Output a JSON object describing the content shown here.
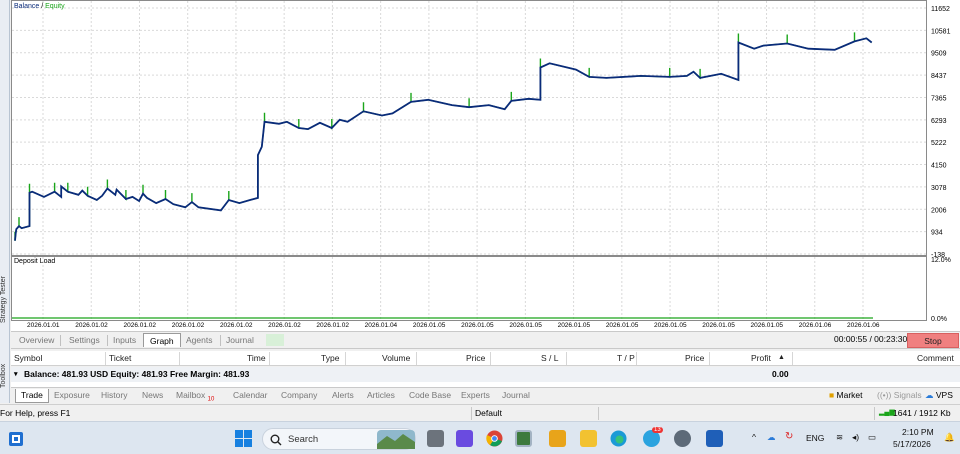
{
  "left_strip": {
    "tester_label": "Strategy Tester",
    "toolbox_label": "Toolbox"
  },
  "chart": {
    "top_label_balance": "Balance",
    "top_label_sep": " / ",
    "top_label_equity": "Equity",
    "y_ticks": [
      "11652",
      "10581",
      "9509",
      "8437",
      "7365",
      "6293",
      "5222",
      "4150",
      "3078",
      "2006",
      "934",
      "-138"
    ],
    "load_label": "Deposit Load",
    "load_ticks": [
      "12.0%",
      "0.0%"
    ],
    "x_ticks": [
      "2026.01.01",
      "2026.01.02",
      "2026.01.02",
      "2026.01.02",
      "2026.01.02",
      "2026.01.02",
      "2026.01.02",
      "2026.01.04",
      "2026.01.05",
      "2026.01.05",
      "2026.01.05",
      "2026.01.05",
      "2026.01.05",
      "2026.01.05",
      "2026.01.05",
      "2026.01.05",
      "2026.01.06",
      "2026.01.06"
    ],
    "colors": {
      "balance": "#0a2b7a",
      "equity": "#1aa51a",
      "grid": "#d9d9d9",
      "load": "#1aa51a"
    }
  },
  "chart_data": {
    "type": "line",
    "title": "Balance / Equity",
    "ylim": [
      -138,
      11652
    ],
    "x_range": [
      "2026.01.01",
      "2026.01.06"
    ],
    "series": [
      {
        "name": "Balance",
        "points": [
          [
            0,
            500
          ],
          [
            0.5,
            850
          ],
          [
            1,
            1050
          ],
          [
            3,
            1200
          ],
          [
            5,
            1100
          ],
          [
            11,
            1200
          ],
          [
            11.01,
            2800
          ],
          [
            13,
            2850
          ],
          [
            22,
            2600
          ],
          [
            30,
            2850
          ],
          [
            35,
            2600
          ],
          [
            35.01,
            3100
          ],
          [
            40,
            2850
          ],
          [
            48,
            2700
          ],
          [
            51,
            2900
          ],
          [
            55,
            2650
          ],
          [
            62,
            2450
          ],
          [
            66,
            2650
          ],
          [
            70,
            3000
          ],
          [
            76,
            2700
          ],
          [
            77,
            2950
          ],
          [
            84,
            2500
          ],
          [
            89,
            2600
          ],
          [
            94,
            2400
          ],
          [
            97,
            2750
          ],
          [
            100,
            2550
          ],
          [
            107,
            2300
          ],
          [
            114,
            2500
          ],
          [
            120,
            2250
          ],
          [
            129,
            2100
          ],
          [
            134,
            2350
          ],
          [
            139,
            2100
          ],
          [
            156,
            1950
          ],
          [
            162,
            2450
          ],
          [
            170,
            2300
          ],
          [
            178,
            2450
          ],
          [
            184,
            2550
          ],
          [
            184.01,
            4600
          ],
          [
            187,
            5000
          ],
          [
            189,
            6200
          ],
          [
            200,
            6100
          ],
          [
            206,
            6200
          ],
          [
            215,
            5900
          ],
          [
            222,
            5850
          ],
          [
            231,
            6150
          ],
          [
            240,
            5900
          ],
          [
            246,
            6300
          ],
          [
            252,
            6200
          ],
          [
            264,
            6700
          ],
          [
            278,
            6500
          ],
          [
            286,
            6600
          ],
          [
            300,
            7150
          ],
          [
            313,
            7250
          ],
          [
            331,
            7000
          ],
          [
            344,
            6900
          ],
          [
            359,
            7000
          ],
          [
            371,
            6800
          ],
          [
            376,
            7200
          ],
          [
            389,
            7300
          ],
          [
            398,
            7250
          ],
          [
            398.01,
            8800
          ],
          [
            405,
            9000
          ],
          [
            425,
            8700
          ],
          [
            435,
            8350
          ],
          [
            448,
            8300
          ],
          [
            474,
            8400
          ],
          [
            496,
            8350
          ],
          [
            509,
            8400
          ],
          [
            514,
            8600
          ],
          [
            519,
            8300
          ],
          [
            535,
            8500
          ],
          [
            548,
            8200
          ],
          [
            548.01,
            10000
          ],
          [
            560,
            9700
          ],
          [
            567,
            9850
          ],
          [
            585,
            9950
          ],
          [
            601,
            9700
          ],
          [
            621,
            9650
          ],
          [
            636,
            10050
          ],
          [
            645,
            10200
          ],
          [
            649,
            10000
          ]
        ]
      },
      {
        "name": "Equity",
        "note_series": "spikes above balance"
      }
    ],
    "x": "ticks listed in x_ticks",
    "xlabel": "",
    "ylabel": ""
  },
  "tester_tabs": {
    "items": [
      "Overview",
      "Settings",
      "Inputs",
      "Graph",
      "Agents",
      "Journal"
    ],
    "active": "Graph",
    "timer": "00:00:55 / 00:23:30",
    "stop_label": "Stop"
  },
  "toolbox": {
    "columns": [
      "Symbol",
      "Ticket",
      "Time",
      "Type",
      "Volume",
      "Price",
      "S / L",
      "T / P",
      "Price",
      "Profit",
      "Comment"
    ],
    "balance_text": "Balance: 481.93 USD  Equity: 481.93  Free Margin: 481.93",
    "profit_total": "0.00",
    "tabs": [
      "Trade",
      "Exposure",
      "History",
      "News",
      "Mailbox",
      "Calendar",
      "Company",
      "Alerts",
      "Articles",
      "Code Base",
      "Experts",
      "Journal"
    ],
    "mailbox_badge": "10",
    "market_label": "Market",
    "signals_label": "Signals",
    "vps_label": "VPS"
  },
  "statusbar": {
    "help": "For Help, press F1",
    "profile": "Default",
    "traffic": "1641 / 1912 Kb"
  },
  "taskbar": {
    "search_placeholder": "Search",
    "lang": "ENG",
    "time": "2:10 PM",
    "date": "5/17/2026",
    "telegram_badge": "13"
  }
}
